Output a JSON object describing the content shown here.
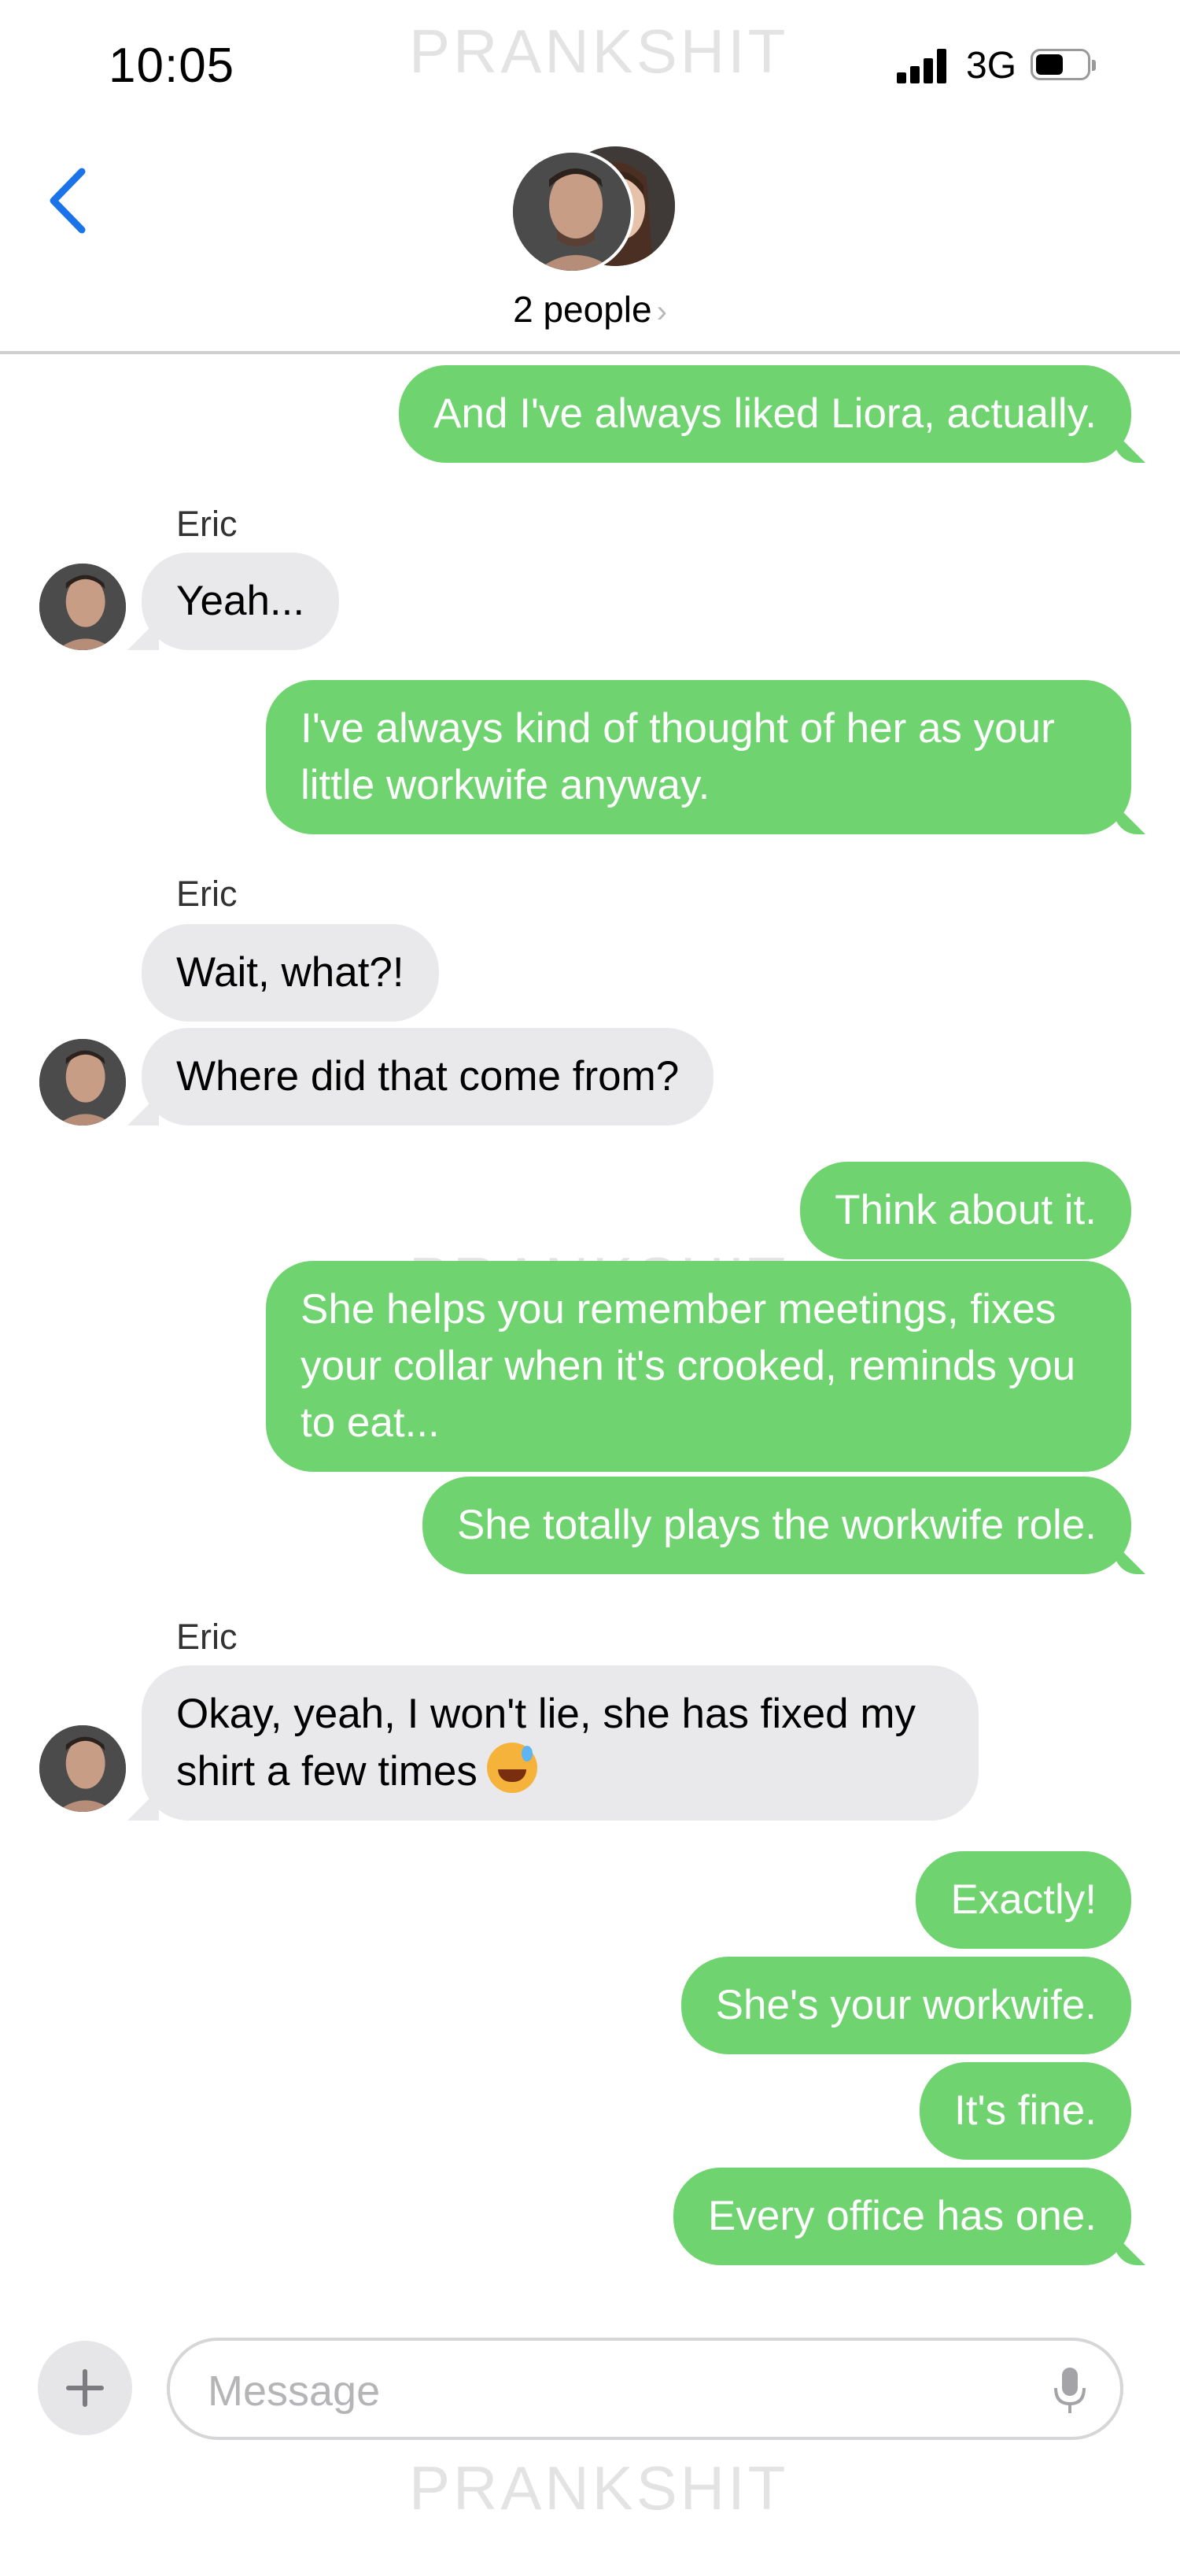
{
  "status_bar": {
    "time": "10:05",
    "network": "3G",
    "battery_level": 0.55
  },
  "watermark": "PRANKSHIT",
  "header": {
    "back_icon": "chevron-left-icon",
    "participants_label": "2 people",
    "chevron": "›"
  },
  "colors": {
    "outgoing_bubble": "#6fd36f",
    "incoming_bubble": "#e9e9eb",
    "accent_blue": "#1a73e8"
  },
  "messages": [
    {
      "direction": "out",
      "text": "And I've always liked Liora, actually."
    },
    {
      "direction": "in",
      "sender": "Eric",
      "text": "Yeah..."
    },
    {
      "direction": "out",
      "text": "I've always kind of thought of her as your little workwife anyway."
    },
    {
      "direction": "in",
      "sender": "Eric",
      "text": "Wait, what?!"
    },
    {
      "direction": "in",
      "text": "Where did that come from?"
    },
    {
      "direction": "out",
      "text": "Think about it."
    },
    {
      "direction": "out",
      "text": "She helps you remember meetings, fixes your collar when it's crooked, reminds you to eat..."
    },
    {
      "direction": "out",
      "text": "She totally plays the workwife role."
    },
    {
      "direction": "in",
      "sender": "Eric",
      "text": "Okay, yeah, I won't lie, she has fixed my shirt a few times",
      "emoji": "sweat-smile-emoji"
    },
    {
      "direction": "out",
      "text": "Exactly!"
    },
    {
      "direction": "out",
      "text": "She's your workwife."
    },
    {
      "direction": "out",
      "text": "It's fine."
    },
    {
      "direction": "out",
      "text": "Every office has one."
    }
  ],
  "trailing_sender": "Eric",
  "composer": {
    "placeholder": "Message",
    "value": "",
    "plus_icon": "plus-icon",
    "mic_icon": "microphone-icon"
  }
}
